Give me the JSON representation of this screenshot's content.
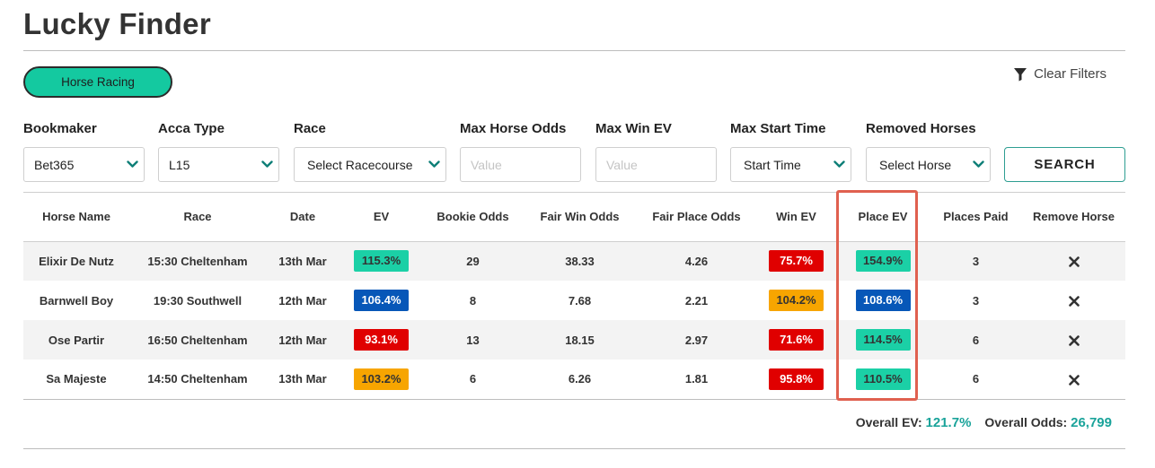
{
  "page": {
    "title": "Lucky Finder"
  },
  "sport_button": {
    "label": "Horse Racing"
  },
  "clear_filters": {
    "label": "Clear Filters",
    "icon": "filter-icon"
  },
  "filters": {
    "bookmaker": {
      "label": "Bookmaker",
      "value": "Bet365"
    },
    "acca_type": {
      "label": "Acca Type",
      "value": "L15"
    },
    "race": {
      "label": "Race",
      "value": "Select Racecourse"
    },
    "max_horse_odds": {
      "label": "Max Horse Odds",
      "value": "",
      "placeholder": "Value"
    },
    "max_win_ev": {
      "label": "Max Win EV",
      "value": "",
      "placeholder": "Value"
    },
    "max_start_time": {
      "label": "Max Start Time",
      "value": "Start Time"
    },
    "removed_horses": {
      "label": "Removed Horses",
      "value": "Select Horse"
    }
  },
  "search_button": {
    "label": "SEARCH"
  },
  "table": {
    "columns": [
      "Horse Name",
      "Race",
      "Date",
      "EV",
      "Bookie Odds",
      "Fair Win Odds",
      "Fair Place Odds",
      "Win EV",
      "Place EV",
      "Places Paid",
      "Remove Horse"
    ],
    "rows": [
      {
        "horse": "Elixir De Nutz",
        "race": "15:30 Cheltenham",
        "date": "13th Mar",
        "ev": "115.3%",
        "ev_color": "green",
        "bookie_odds": "29",
        "fair_win_odds": "38.33",
        "fair_place_odds": "4.26",
        "win_ev": "75.7%",
        "win_ev_color": "red",
        "place_ev": "154.9%",
        "place_ev_color": "green",
        "places_paid": "3"
      },
      {
        "horse": "Barnwell Boy",
        "race": "19:30 Southwell",
        "date": "12th Mar",
        "ev": "106.4%",
        "ev_color": "blue",
        "bookie_odds": "8",
        "fair_win_odds": "7.68",
        "fair_place_odds": "2.21",
        "win_ev": "104.2%",
        "win_ev_color": "orange",
        "place_ev": "108.6%",
        "place_ev_color": "blue",
        "places_paid": "3"
      },
      {
        "horse": "Ose Partir",
        "race": "16:50 Cheltenham",
        "date": "12th Mar",
        "ev": "93.1%",
        "ev_color": "red",
        "bookie_odds": "13",
        "fair_win_odds": "18.15",
        "fair_place_odds": "2.97",
        "win_ev": "71.6%",
        "win_ev_color": "red",
        "place_ev": "114.5%",
        "place_ev_color": "green",
        "places_paid": "6"
      },
      {
        "horse": "Sa Majeste",
        "race": "14:50 Cheltenham",
        "date": "13th Mar",
        "ev": "103.2%",
        "ev_color": "orange",
        "bookie_odds": "6",
        "fair_win_odds": "6.26",
        "fair_place_odds": "1.81",
        "win_ev": "95.8%",
        "win_ev_color": "red",
        "place_ev": "110.5%",
        "place_ev_color": "green",
        "places_paid": "6"
      }
    ]
  },
  "summary": {
    "overall_ev_label": "Overall EV:",
    "overall_ev": "121.7%",
    "overall_odds_label": "Overall Odds:",
    "overall_odds": "26,799"
  },
  "colors": {
    "accent": "#14c9a0",
    "green": "#1bd0a6",
    "blue": "#0757b8",
    "red": "#e00000",
    "orange": "#f7a500",
    "teal_text": "#1aa39a",
    "highlight": "#e0604f"
  }
}
